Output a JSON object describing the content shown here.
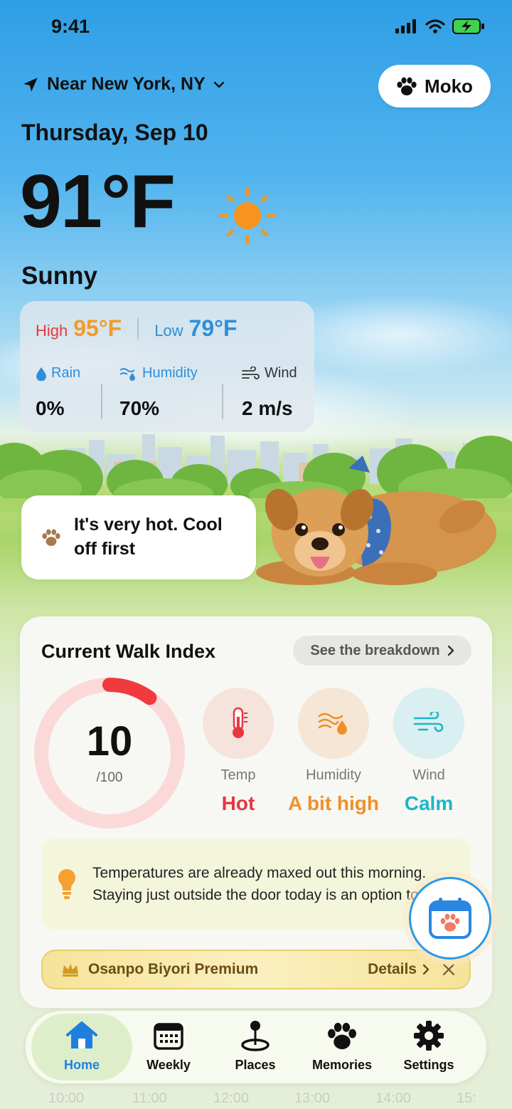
{
  "status_bar": {
    "time": "9:41"
  },
  "header": {
    "location": "Near New York, NY",
    "pet_name": "Moko",
    "date": "Thursday, Sep 10",
    "temperature": "91°F",
    "condition": "Sunny"
  },
  "weather": {
    "high_label": "High",
    "high_value": "95°F",
    "low_label": "Low",
    "low_value": "79°F",
    "stats": [
      {
        "label": "Rain",
        "value": "0%",
        "icon": "droplet-icon"
      },
      {
        "label": "Humidity",
        "value": "70%",
        "icon": "humidity-icon"
      },
      {
        "label": "Wind",
        "value": "2 m/s",
        "icon": "wind-icon"
      }
    ]
  },
  "advice": {
    "text": "It's very hot. Cool off first"
  },
  "walk_index": {
    "title": "Current Walk Index",
    "breakdown_label": "See the breakdown",
    "score": "10",
    "score_max": "/100",
    "score_fraction": 0.1,
    "factors": [
      {
        "label": "Temp",
        "value": "Hot",
        "color": "#e8363f",
        "bg": "#f6e3dc",
        "icon": "thermometer-icon"
      },
      {
        "label": "Humidity",
        "value": "A bit high",
        "color": "#f0902a",
        "bg": "#f6e6d6",
        "icon": "humidity-drop-icon"
      },
      {
        "label": "Wind",
        "value": "Calm",
        "color": "#1fb5c9",
        "bg": "#d9eff1",
        "icon": "wind-icon"
      }
    ],
    "tip": "Temperatures are already maxed out this morning. Staying just outside the door today is an option too.",
    "premium_label": "Osanpo Biyori Premium",
    "premium_details": "Details"
  },
  "tabs": [
    {
      "label": "Home",
      "icon": "home-icon",
      "active": true
    },
    {
      "label": "Weekly",
      "icon": "calendar-grid-icon",
      "active": false
    },
    {
      "label": "Places",
      "icon": "map-pin-icon",
      "active": false
    },
    {
      "label": "Memories",
      "icon": "paw-icon",
      "active": false
    },
    {
      "label": "Settings",
      "icon": "gear-icon",
      "active": false
    }
  ],
  "hours": [
    "10:00",
    "11:00",
    "12:00",
    "13:00",
    "14:00",
    "15:"
  ],
  "colors": {
    "accent": "#1f7fe0",
    "high": "#f39a2b",
    "low": "#2d8fdb",
    "gauge": "#f03a3e",
    "gauge_track": "#fbd9d9"
  }
}
